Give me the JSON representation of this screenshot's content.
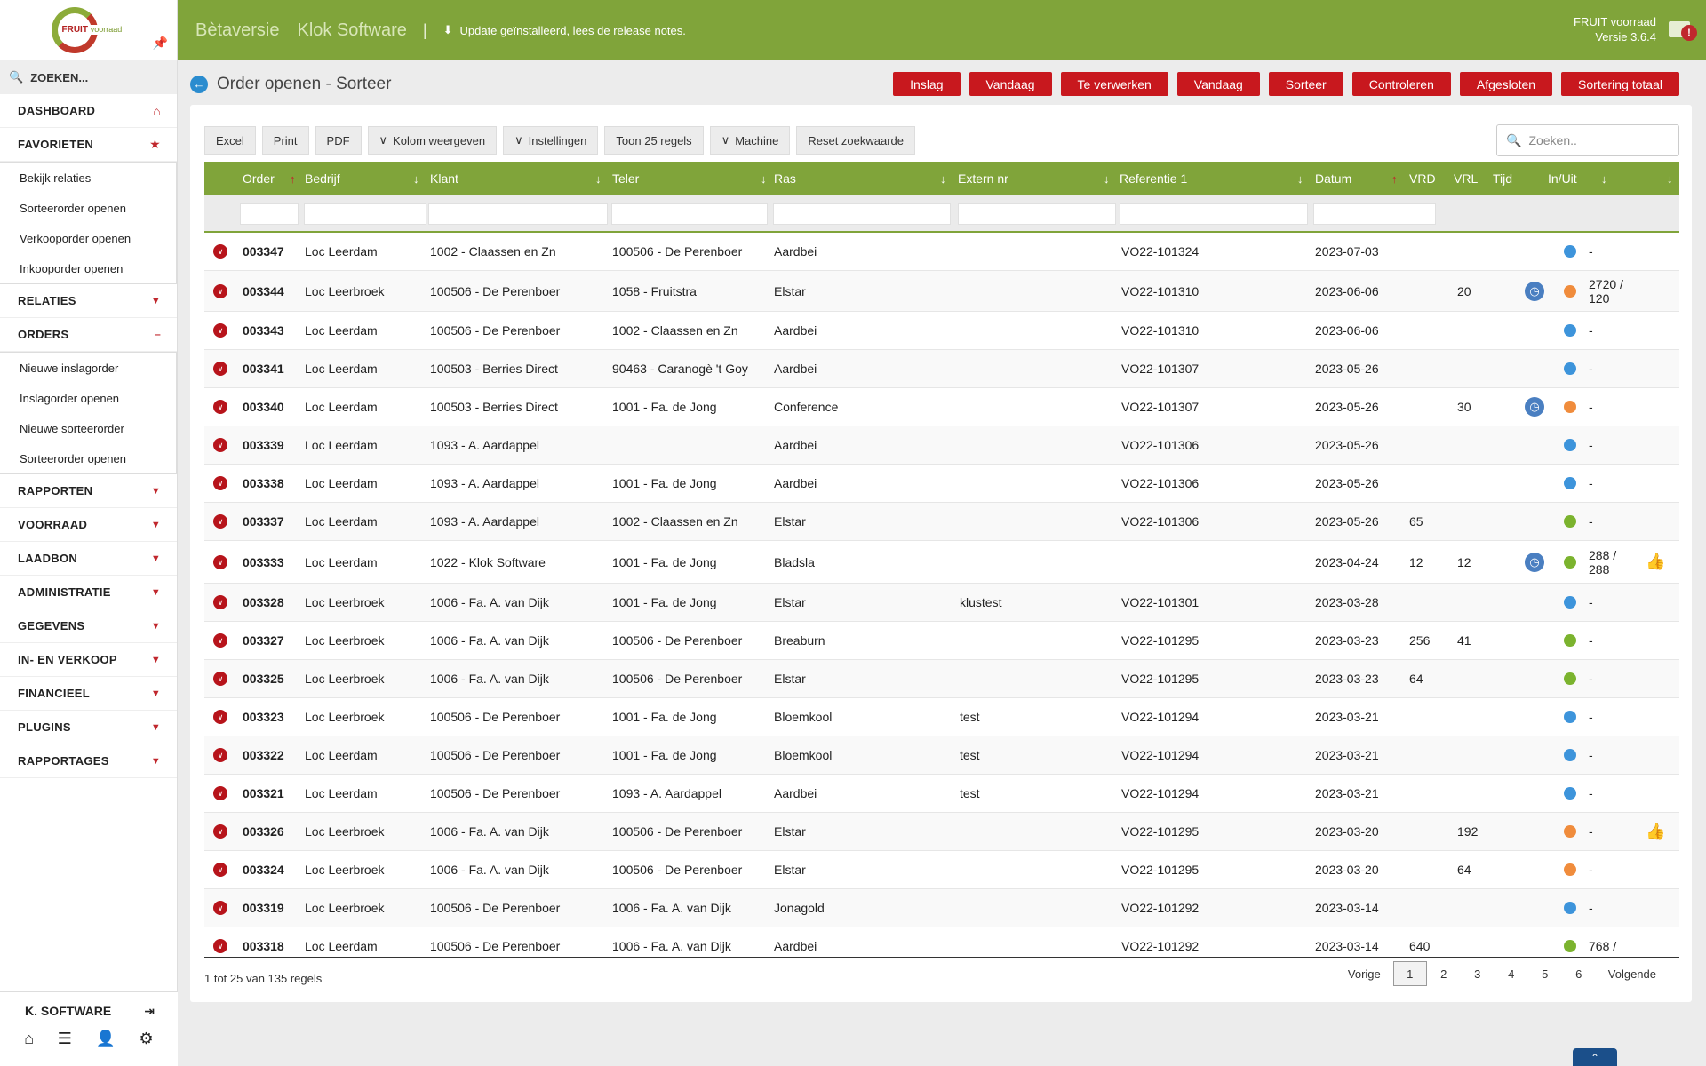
{
  "brand": {
    "logo_main": "FRUIT",
    "logo_sub": "voorraad"
  },
  "topbar": {
    "title1": "Bètaversie",
    "title2": "Klok Software",
    "separator": "|",
    "update": "Update geïnstalleerd, lees de release notes.",
    "app_name": "FRUIT voorraad",
    "version": "Versie 3.6.4",
    "mail_badge": "!"
  },
  "sidebar": {
    "search": "ZOEKEN...",
    "sections": [
      {
        "label": "DASHBOARD"
      },
      {
        "label": "FAVORIETEN"
      },
      {
        "label": "RELATIES"
      },
      {
        "label": "ORDERS"
      },
      {
        "label": "RAPPORTEN"
      },
      {
        "label": "VOORRAAD"
      },
      {
        "label": "LAADBON"
      },
      {
        "label": "ADMINISTRATIE"
      },
      {
        "label": "GEGEVENS"
      },
      {
        "label": "IN- EN VERKOOP"
      },
      {
        "label": "FINANCIEEL"
      },
      {
        "label": "PLUGINS"
      },
      {
        "label": "RAPPORTAGES"
      }
    ],
    "favorites": [
      "Bekijk relaties",
      "Sorteerorder openen",
      "Verkooporder openen",
      "Inkooporder openen"
    ],
    "orders": [
      "Nieuwe inslagorder",
      "Inslagorder openen",
      "Nieuwe sorteerorder",
      "Sorteerorder openen"
    ],
    "user": "K. SOFTWARE"
  },
  "page": {
    "title": "Order openen - Sorteer",
    "buttons": [
      "Inslag",
      "Vandaag",
      "Te verwerken",
      "Vandaag",
      "Sorteer",
      "Controleren",
      "Afgesloten",
      "Sortering totaal"
    ]
  },
  "toolbar": {
    "buttons": [
      "Excel",
      "Print",
      "PDF",
      "Kolom weergeven",
      "Instellingen",
      "Toon 25 regels",
      "Machine",
      "Reset zoekwaarde"
    ],
    "search_placeholder": "Zoeken.."
  },
  "table": {
    "columns": [
      "Order",
      "Bedrijf",
      "Klant",
      "Teler",
      "Ras",
      "Extern nr",
      "Referentie 1",
      "Datum",
      "VRD",
      "VRL",
      "Tijd",
      "In/Uit"
    ],
    "rows": [
      {
        "order": "003347",
        "bedrijf": "Loc Leerdam",
        "klant": "1002 - Claassen en Zn",
        "teler": "100506 - De Perenboer",
        "ras": "Aardbei",
        "extern": "",
        "ref": "VO22-101324",
        "datum": "2023-07-03",
        "vrd": "",
        "vrl": "",
        "clock": false,
        "status": "#3d94db",
        "inuit": "-",
        "thumb": false
      },
      {
        "order": "003344",
        "bedrijf": "Loc Leerbroek",
        "klant": "100506 - De Perenboer",
        "teler": "1058 - Fruitstra",
        "ras": "Elstar",
        "extern": "",
        "ref": "VO22-101310",
        "datum": "2023-06-06",
        "vrd": "",
        "vrl": "20",
        "clock": true,
        "status": "#f08c3c",
        "inuit": "2720 /",
        "inuit2": "120",
        "thumb": false
      },
      {
        "order": "003343",
        "bedrijf": "Loc Leerdam",
        "klant": "100506 - De Perenboer",
        "teler": "1002 - Claassen en Zn",
        "ras": "Aardbei",
        "extern": "",
        "ref": "VO22-101310",
        "datum": "2023-06-06",
        "vrd": "",
        "vrl": "",
        "clock": false,
        "status": "#3d94db",
        "inuit": "-",
        "thumb": false
      },
      {
        "order": "003341",
        "bedrijf": "Loc Leerdam",
        "klant": "100503 - Berries Direct",
        "teler": "90463 - Caranogè 't Goy",
        "ras": "Aardbei",
        "extern": "",
        "ref": "VO22-101307",
        "datum": "2023-05-26",
        "vrd": "",
        "vrl": "",
        "clock": false,
        "status": "#3d94db",
        "inuit": "-",
        "thumb": false
      },
      {
        "order": "003340",
        "bedrijf": "Loc Leerdam",
        "klant": "100503 - Berries Direct",
        "teler": "1001 - Fa. de Jong",
        "ras": "Conference",
        "extern": "",
        "ref": "VO22-101307",
        "datum": "2023-05-26",
        "vrd": "",
        "vrl": "30",
        "clock": true,
        "status": "#f08c3c",
        "inuit": "-",
        "thumb": false
      },
      {
        "order": "003339",
        "bedrijf": "Loc Leerdam",
        "klant": "1093 - A. Aardappel",
        "teler": "",
        "ras": "Aardbei",
        "extern": "",
        "ref": "VO22-101306",
        "datum": "2023-05-26",
        "vrd": "",
        "vrl": "",
        "clock": false,
        "status": "#3d94db",
        "inuit": "-",
        "thumb": false
      },
      {
        "order": "003338",
        "bedrijf": "Loc Leerdam",
        "klant": "1093 - A. Aardappel",
        "teler": "1001 - Fa. de Jong",
        "ras": "Aardbei",
        "extern": "",
        "ref": "VO22-101306",
        "datum": "2023-05-26",
        "vrd": "",
        "vrl": "",
        "clock": false,
        "status": "#3d94db",
        "inuit": "-",
        "thumb": false
      },
      {
        "order": "003337",
        "bedrijf": "Loc Leerdam",
        "klant": "1093 - A. Aardappel",
        "teler": "1002 - Claassen en Zn",
        "ras": "Elstar",
        "extern": "",
        "ref": "VO22-101306",
        "datum": "2023-05-26",
        "vrd": "65",
        "vrl": "",
        "clock": false,
        "status": "#7bb32e",
        "inuit": "-",
        "thumb": false
      },
      {
        "order": "003333",
        "bedrijf": "Loc Leerdam",
        "klant": "1022 - Klok Software",
        "teler": "1001 - Fa. de Jong",
        "ras": "Bladsla",
        "extern": "",
        "ref": "",
        "datum": "2023-04-24",
        "vrd": "12",
        "vrl": "12",
        "clock": true,
        "status": "#7bb32e",
        "inuit": "288 /",
        "inuit2": "288",
        "thumb": true
      },
      {
        "order": "003328",
        "bedrijf": "Loc Leerbroek",
        "klant": "1006 - Fa. A. van Dijk",
        "teler": "1001 - Fa. de Jong",
        "ras": "Elstar",
        "extern": "klustest",
        "ref": "VO22-101301",
        "datum": "2023-03-28",
        "vrd": "",
        "vrl": "",
        "clock": false,
        "status": "#3d94db",
        "inuit": "-",
        "thumb": false
      },
      {
        "order": "003327",
        "bedrijf": "Loc Leerbroek",
        "klant": "1006 - Fa. A. van Dijk",
        "teler": "100506 - De Perenboer",
        "ras": "Breaburn",
        "extern": "",
        "ref": "VO22-101295",
        "datum": "2023-03-23",
        "vrd": "256",
        "vrl": "41",
        "clock": false,
        "status": "#7bb32e",
        "inuit": "-",
        "thumb": false
      },
      {
        "order": "003325",
        "bedrijf": "Loc Leerbroek",
        "klant": "1006 - Fa. A. van Dijk",
        "teler": "100506 - De Perenboer",
        "ras": "Elstar",
        "extern": "",
        "ref": "VO22-101295",
        "datum": "2023-03-23",
        "vrd": "64",
        "vrl": "",
        "clock": false,
        "status": "#7bb32e",
        "inuit": "-",
        "thumb": false
      },
      {
        "order": "003323",
        "bedrijf": "Loc Leerbroek",
        "klant": "100506 - De Perenboer",
        "teler": "1001 - Fa. de Jong",
        "ras": "Bloemkool",
        "extern": "test",
        "ref": "VO22-101294",
        "datum": "2023-03-21",
        "vrd": "",
        "vrl": "",
        "clock": false,
        "status": "#3d94db",
        "inuit": "-",
        "thumb": false
      },
      {
        "order": "003322",
        "bedrijf": "Loc Leerdam",
        "klant": "100506 - De Perenboer",
        "teler": "1001 - Fa. de Jong",
        "ras": "Bloemkool",
        "extern": "test",
        "ref": "VO22-101294",
        "datum": "2023-03-21",
        "vrd": "",
        "vrl": "",
        "clock": false,
        "status": "#3d94db",
        "inuit": "-",
        "thumb": false
      },
      {
        "order": "003321",
        "bedrijf": "Loc Leerdam",
        "klant": "100506 - De Perenboer",
        "teler": "1093 - A. Aardappel",
        "ras": "Aardbei",
        "extern": "test",
        "ref": "VO22-101294",
        "datum": "2023-03-21",
        "vrd": "",
        "vrl": "",
        "clock": false,
        "status": "#3d94db",
        "inuit": "-",
        "thumb": false
      },
      {
        "order": "003326",
        "bedrijf": "Loc Leerbroek",
        "klant": "1006 - Fa. A. van Dijk",
        "teler": "100506 - De Perenboer",
        "ras": "Elstar",
        "extern": "",
        "ref": "VO22-101295",
        "datum": "2023-03-20",
        "vrd": "",
        "vrl": "192",
        "clock": false,
        "status": "#f08c3c",
        "inuit": "-",
        "thumb": true
      },
      {
        "order": "003324",
        "bedrijf": "Loc Leerbroek",
        "klant": "1006 - Fa. A. van Dijk",
        "teler": "100506 - De Perenboer",
        "ras": "Elstar",
        "extern": "",
        "ref": "VO22-101295",
        "datum": "2023-03-20",
        "vrd": "",
        "vrl": "64",
        "clock": false,
        "status": "#f08c3c",
        "inuit": "-",
        "thumb": false
      },
      {
        "order": "003319",
        "bedrijf": "Loc Leerbroek",
        "klant": "100506 - De Perenboer",
        "teler": "1006 - Fa. A. van Dijk",
        "ras": "Jonagold",
        "extern": "",
        "ref": "VO22-101292",
        "datum": "2023-03-14",
        "vrd": "",
        "vrl": "",
        "clock": false,
        "status": "#3d94db",
        "inuit": "-",
        "thumb": false
      },
      {
        "order": "003318",
        "bedrijf": "Loc Leerdam",
        "klant": "100506 - De Perenboer",
        "teler": "1006 - Fa. A. van Dijk",
        "ras": "Aardbei",
        "extern": "",
        "ref": "VO22-101292",
        "datum": "2023-03-14",
        "vrd": "640",
        "vrl": "",
        "clock": false,
        "status": "#7bb32e",
        "inuit": "768 /",
        "thumb": false
      }
    ]
  },
  "footer": {
    "info": "1 tot 25 van 135 regels",
    "prev": "Vorige",
    "pages": [
      "1",
      "2",
      "3",
      "4",
      "5",
      "6"
    ],
    "next": "Volgende"
  },
  "colors": {
    "accent_green": "#80a43a",
    "button_red": "#c8181e"
  }
}
